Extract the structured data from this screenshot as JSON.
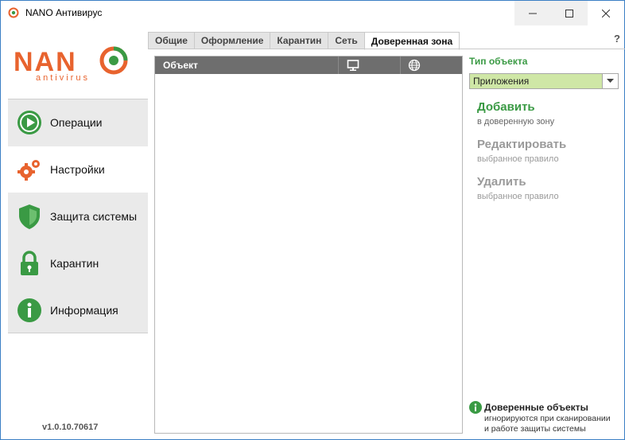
{
  "window": {
    "title": "NANO Антивирус",
    "colors": {
      "accent_green": "#3a9a44",
      "accent_orange": "#e8632e",
      "select_bg": "#cfe7a6"
    }
  },
  "logo": {
    "word": "NANO",
    "sub": "antivirus"
  },
  "sidebar": {
    "items": [
      {
        "label": "Операции",
        "icon": "play-circle-icon"
      },
      {
        "label": "Настройки",
        "icon": "gears-icon",
        "active": true
      },
      {
        "label": "Защита системы",
        "icon": "shield-icon"
      },
      {
        "label": "Карантин",
        "icon": "lock-icon"
      },
      {
        "label": "Информация",
        "icon": "info-circle-icon"
      }
    ],
    "version": "v1.0.10.70617"
  },
  "tabs": [
    {
      "label": "Общие"
    },
    {
      "label": "Оформление"
    },
    {
      "label": "Карантин"
    },
    {
      "label": "Сеть"
    },
    {
      "label": "Доверенная зона",
      "active": true
    }
  ],
  "help": "?",
  "list": {
    "columns": [
      {
        "label": "Объект"
      },
      {
        "icon": "monitor-icon"
      },
      {
        "icon": "globe-icon"
      }
    ],
    "rows": []
  },
  "right": {
    "type_label": "Тип объекта",
    "type_value": "Приложения",
    "actions": [
      {
        "title": "Добавить",
        "sub": "в доверенную зону",
        "enabled": true
      },
      {
        "title": "Редактировать",
        "sub": "выбранное правило",
        "enabled": false
      },
      {
        "title": "Удалить",
        "sub": "выбранное правило",
        "enabled": false
      }
    ],
    "info": {
      "title": "Доверенные объекты",
      "line1": "игнорируются при сканировании",
      "line2": "и работе защиты системы"
    }
  }
}
